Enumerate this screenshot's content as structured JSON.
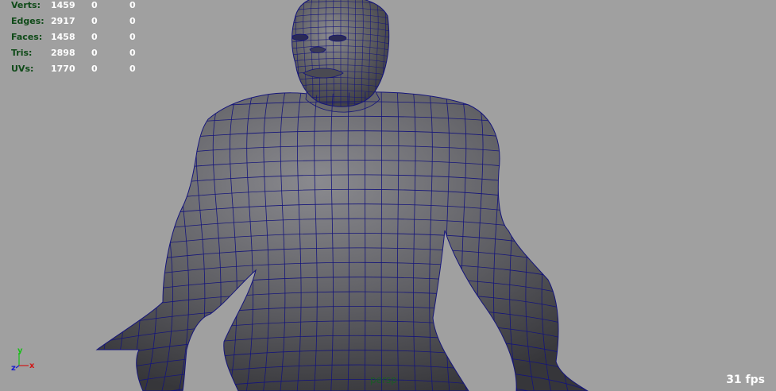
{
  "viewport": {
    "camera": "persp",
    "fps": "31 fps"
  },
  "hud": {
    "rows": [
      {
        "label": "Verts:",
        "v1": "1459",
        "v2": "0",
        "v3": "0"
      },
      {
        "label": "Edges:",
        "v1": "2917",
        "v2": "0",
        "v3": "0"
      },
      {
        "label": "Faces:",
        "v1": "1458",
        "v2": "0",
        "v3": "0"
      },
      {
        "label": "Tris:",
        "v1": "2898",
        "v2": "0",
        "v3": "0"
      },
      {
        "label": "UVs:",
        "v1": "1770",
        "v2": "0",
        "v3": "0"
      }
    ]
  },
  "axis": {
    "y": "y",
    "x": "x",
    "z": "z"
  },
  "colors": {
    "background": "#a0a0a0",
    "mesh_fill": "#5d5d62",
    "wireframe": "#15157a",
    "hud_label": "#0f4a18",
    "hud_value": "#ffffff",
    "axis_x": "#d01818",
    "axis_y": "#18c018",
    "axis_z": "#1818d0"
  }
}
